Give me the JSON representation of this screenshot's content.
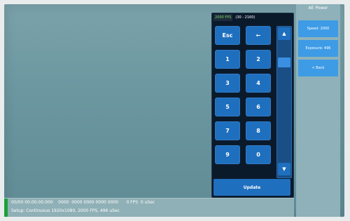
{
  "keypad": {
    "fps_label": "2000 FPS",
    "range_label": "(30 - 2160)",
    "keys": {
      "esc": "Esc",
      "backspace": "←",
      "k1": "1",
      "k2": "2",
      "k3": "3",
      "k4": "4",
      "k5": "5",
      "k6": "6",
      "k7": "7",
      "k8": "8",
      "k9": "9",
      "k0": "0"
    },
    "update_label": "Update",
    "scroll_up_symbol": "▲",
    "scroll_down_symbol": "▼"
  },
  "right_menu": {
    "title": "AE Power",
    "items": [
      {
        "label": "Speed: 2000"
      },
      {
        "label": "Exposure: 496"
      },
      {
        "label": "< Back"
      }
    ]
  },
  "status": {
    "line1": "00/00 00:00:00.000    0000  0000 0000 0000 0000      0 FPS  0 uSec",
    "line2": "Setup: Continuous 1920x1080, 2000 FPS, 496 uSec"
  },
  "colors": {
    "key_blue": "#1f6fbf",
    "menu_blue": "#3e9be6",
    "panel_dark": "#0b1a2b",
    "green_indicator": "#1ca03a",
    "screen_teal": "#6b969f"
  }
}
